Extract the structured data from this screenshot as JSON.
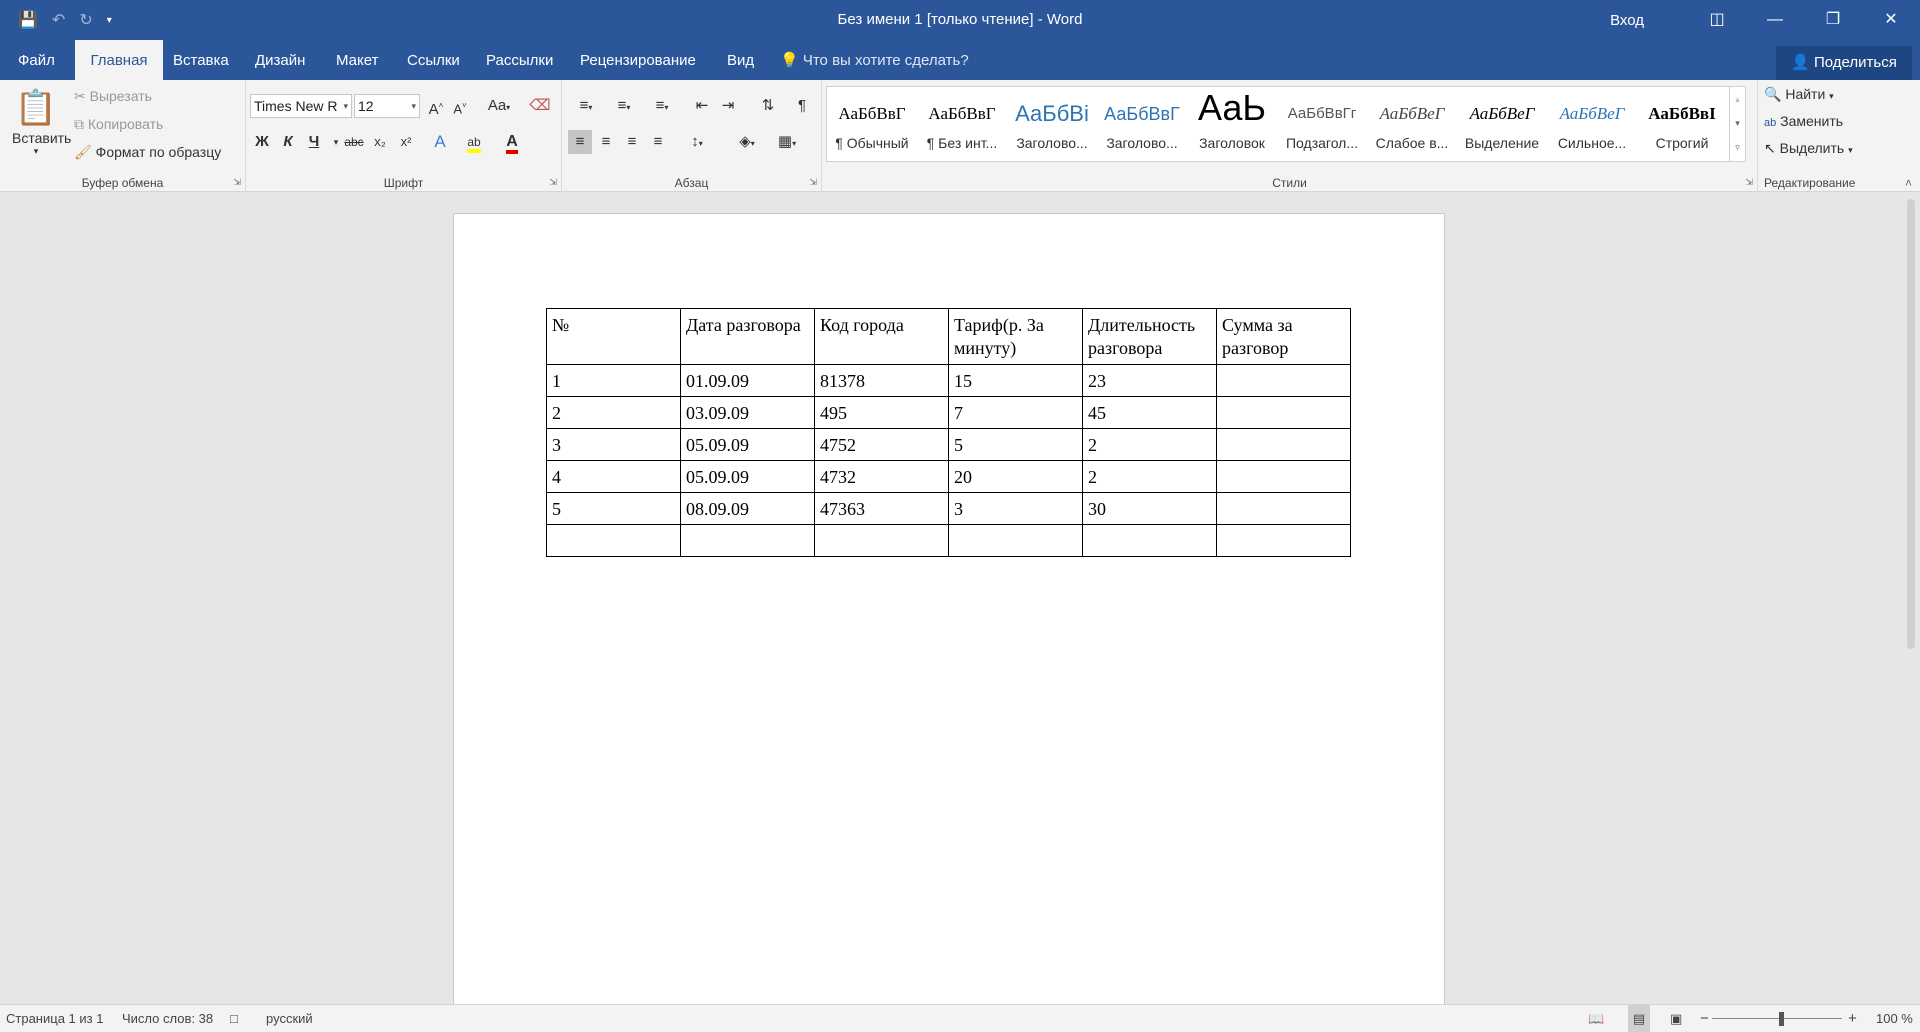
{
  "window": {
    "title": "Без имени 1 [только чтение]  -  Word",
    "login": "Вход",
    "share": "Поделиться"
  },
  "qat_icons": [
    "save-icon",
    "undo-icon",
    "redo-icon",
    "customize-icon"
  ],
  "tabs": [
    "Файл",
    "Главная",
    "Вставка",
    "Дизайн",
    "Макет",
    "Ссылки",
    "Рассылки",
    "Рецензирование",
    "Вид"
  ],
  "active_tab": "Главная",
  "tellme": "Что вы хотите сделать?",
  "clipboard": {
    "paste": "Вставить",
    "cut": "Вырезать",
    "copy": "Копировать",
    "format_painter": "Формат по образцу",
    "label": "Буфер обмена"
  },
  "font": {
    "name": "Times New R",
    "size": "12",
    "grow": "A",
    "shrink": "A",
    "case": "Aa",
    "bold": "Ж",
    "italic": "К",
    "underline": "Ч",
    "strike": "abc",
    "sub": "x₂",
    "sup": "x²",
    "label": "Шрифт"
  },
  "paragraph": {
    "label": "Абзац",
    "pilcrow": "¶"
  },
  "styles": {
    "label": "Стили",
    "items": [
      {
        "preview": "АаБбВвГ",
        "name": "¶ Обычный"
      },
      {
        "preview": "АаБбВвГ",
        "name": "¶ Без инт..."
      },
      {
        "preview": "АаБбВі",
        "name": "Заголово..."
      },
      {
        "preview": "АаБбВвГ",
        "name": "Заголово..."
      },
      {
        "preview": "АаЬ",
        "name": "Заголовок"
      },
      {
        "preview": "АаБбВвГг",
        "name": "Подзагол..."
      },
      {
        "preview": "АаБбВеГ",
        "name": "Слабое в..."
      },
      {
        "preview": "АаБбВеГ",
        "name": "Выделение"
      },
      {
        "preview": "АаБбВеГ",
        "name": "Сильное..."
      },
      {
        "preview": "АаБбВвІ",
        "name": "Строгий"
      }
    ]
  },
  "editing": {
    "find": "Найти",
    "replace": "Заменить",
    "select": "Выделить",
    "label": "Редактирование"
  },
  "table": {
    "header": [
      "№",
      "Дата разговора",
      "Код города",
      "Тариф(р. За минуту)",
      "Длительность разговора",
      "Сумма за разговор"
    ],
    "rows": [
      [
        "1",
        "01.09.09",
        "81378",
        "15",
        "23",
        ""
      ],
      [
        "2",
        "03.09.09",
        "495",
        "7",
        "45",
        ""
      ],
      [
        "3",
        "05.09.09",
        "4752",
        "5",
        "2",
        ""
      ],
      [
        "4",
        "05.09.09",
        "4732",
        "20",
        "2",
        ""
      ],
      [
        "5",
        "08.09.09",
        "47363",
        "3",
        "30",
        ""
      ],
      [
        "",
        "",
        "",
        "",
        "",
        ""
      ]
    ]
  },
  "status": {
    "page": "Страница 1 из 1",
    "words": "Число слов: 38",
    "language": "русский",
    "zoom": "100 %",
    "zoom_minus": "−",
    "zoom_plus": "+"
  }
}
